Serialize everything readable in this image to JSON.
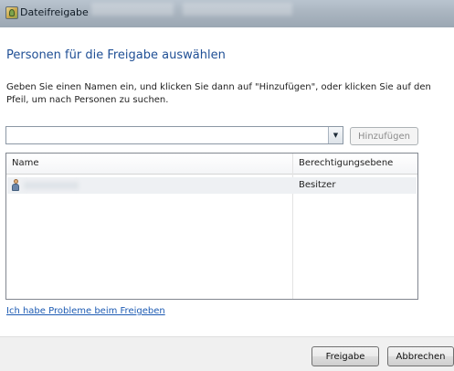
{
  "window": {
    "title": "Dateifreigabe"
  },
  "dialog": {
    "heading": "Personen für die Freigabe auswählen",
    "instructions": "Geben Sie einen Namen ein, und klicken Sie dann auf \"Hinzufügen\", oder klicken Sie auf den Pfeil, um nach Personen zu suchen.",
    "name_input_value": "",
    "add_button": "Hinzufügen"
  },
  "list": {
    "columns": [
      "Name",
      "Berechtigungsebene"
    ],
    "rows": [
      {
        "name": "",
        "permission": "Besitzer",
        "icon": "user-icon"
      }
    ]
  },
  "help_link": "Ich habe Probleme beim Freigeben",
  "footer": {
    "share_button": "Freigabe",
    "cancel_button": "Abbrechen"
  },
  "colors": {
    "heading": "#1f4f95",
    "link": "#1d5bb3",
    "titlebar": "#aab5c0",
    "selected_row": "#eef0f3"
  }
}
